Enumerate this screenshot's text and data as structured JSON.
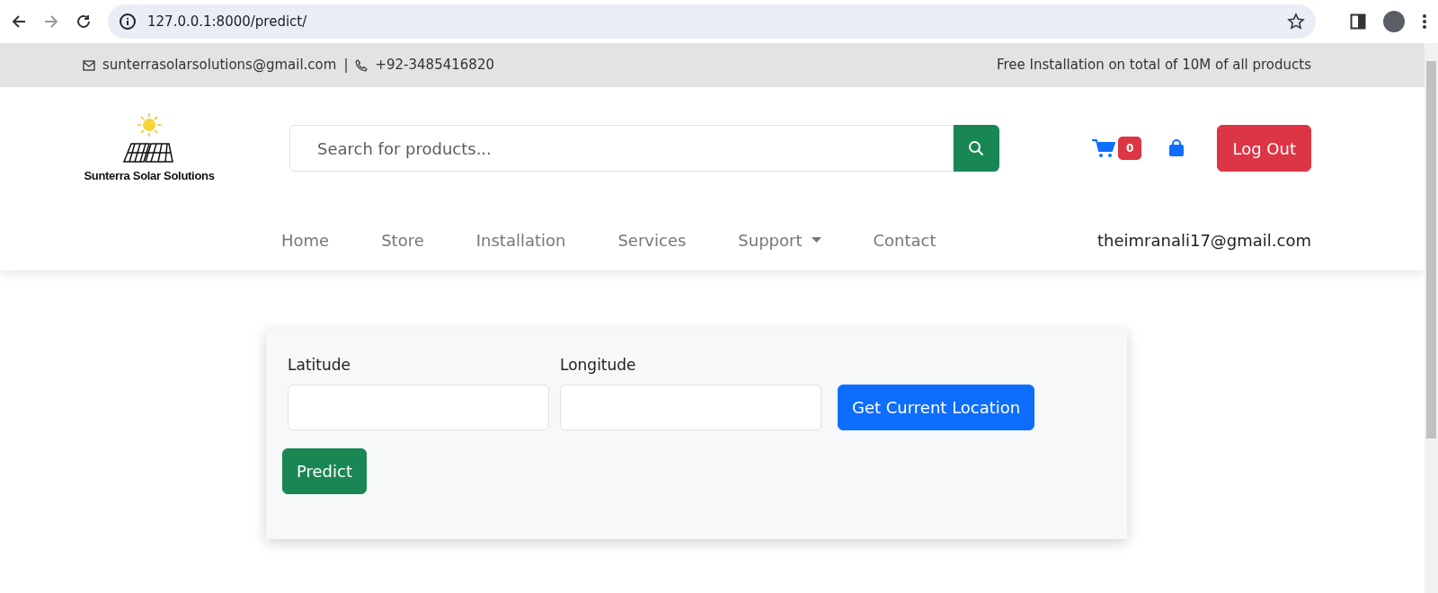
{
  "browser": {
    "url": "127.0.0.1:8000/predict/"
  },
  "top_bar": {
    "email": "sunterrasolarsolutions@gmail.com",
    "separator": "|",
    "phone": "+92-3485416820",
    "promo": "Free Installation on total of 10M of all products"
  },
  "header": {
    "logo_text": "Sunterra Solar Solutions",
    "search": {
      "placeholder": "Search for products..."
    },
    "cart_count": "0",
    "logout": "Log Out"
  },
  "nav": {
    "items": [
      {
        "label": "Home",
        "selected": false,
        "dropdown": false
      },
      {
        "label": "Store",
        "selected": false,
        "dropdown": false
      },
      {
        "label": "Installation",
        "selected": false,
        "dropdown": false
      },
      {
        "label": "Services",
        "selected": false,
        "dropdown": false
      },
      {
        "label": "Support",
        "selected": false,
        "dropdown": true
      },
      {
        "label": "Contact",
        "selected": false,
        "dropdown": false
      }
    ],
    "user": "theimranali17@gmail.com"
  },
  "form": {
    "fields": [
      {
        "label": "Latitude"
      },
      {
        "label": "Longitude"
      }
    ],
    "locate_button": "Get Current Location",
    "submit": "Predict"
  }
}
